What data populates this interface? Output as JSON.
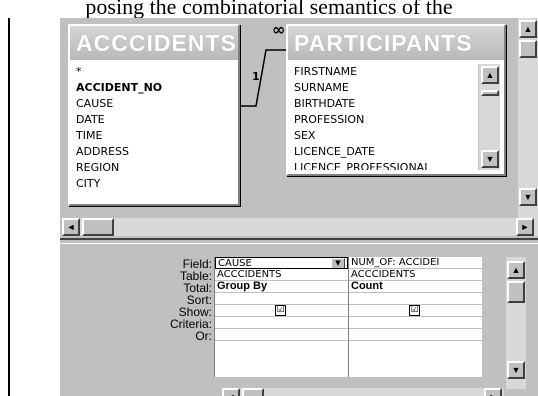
{
  "caption": "posing the combinatorial semantics of the",
  "tables": {
    "accidents": {
      "title": "ACCCIDENTS",
      "fields": [
        "*",
        "ACCIDENT_NO",
        "CAUSE",
        "DATE",
        "TIME",
        "ADDRESS",
        "REGION",
        "CITY"
      ]
    },
    "participants": {
      "title": "PARTICIPANTS",
      "fields": [
        "FIRSTNAME",
        "SURNAME",
        "BIRTHDATE",
        "PROFESSION",
        "SEX",
        "LICENCE_DATE",
        "LICENCE_PROFESSIONAL"
      ]
    }
  },
  "join": {
    "one_side": "1",
    "many_side": "∞"
  },
  "grid": {
    "row_labels": [
      "Field:",
      "Table:",
      "Total:",
      "Sort:",
      "Show:",
      "Criteria:",
      "Or:"
    ],
    "columns": [
      {
        "field": "CAUSE",
        "table": "ACCCIDENTS",
        "total": "Group By",
        "sort": "",
        "show": "☑",
        "criteria": "",
        "or": ""
      },
      {
        "field": "NUM_OF: ACCIDEI",
        "table": "ACCCIDENTS",
        "total": "Count",
        "sort": "",
        "show": "☑",
        "criteria": "",
        "or": ""
      }
    ]
  },
  "icons": {
    "scroll_up": "▲",
    "scroll_down": "▼",
    "scroll_left": "◄",
    "scroll_right": "►",
    "combo_down": "▼"
  }
}
